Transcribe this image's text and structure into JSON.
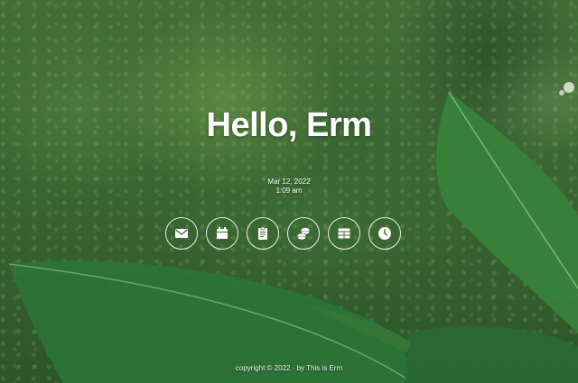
{
  "greeting": "Hello, Erm",
  "date": "Mar 12, 2022",
  "time": "1:09 am",
  "footer": "copyright © 2022 · by This is Erm",
  "icons": [
    "mail-icon",
    "calendar-icon",
    "clipboard-icon",
    "coins-icon",
    "table-icon",
    "clock-icon"
  ],
  "colors": {
    "text": "#ffffff",
    "foliage": "#3d6d35",
    "leaf": "#2f7a3a"
  }
}
